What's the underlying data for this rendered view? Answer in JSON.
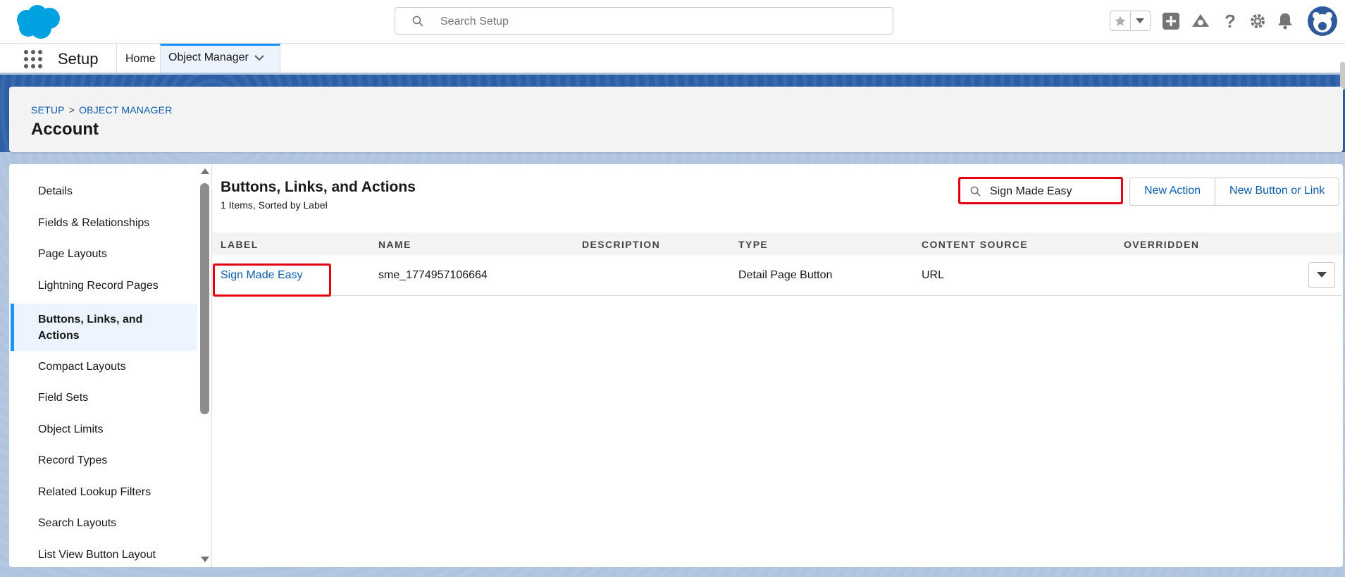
{
  "header": {
    "search_placeholder": "Search Setup"
  },
  "nav": {
    "app_name": "Setup",
    "tabs": [
      {
        "label": "Home"
      },
      {
        "label": "Object Manager"
      }
    ]
  },
  "page": {
    "breadcrumb": [
      "SETUP",
      "OBJECT MANAGER"
    ],
    "breadcrumb_separator": ">",
    "title": "Account"
  },
  "sidebar": {
    "items": [
      {
        "label": "Details"
      },
      {
        "label": "Fields & Relationships"
      },
      {
        "label": "Page Layouts"
      },
      {
        "label": "Lightning Record Pages"
      },
      {
        "label": "Buttons, Links, and Actions",
        "active": true
      },
      {
        "label": "Compact Layouts"
      },
      {
        "label": "Field Sets"
      },
      {
        "label": "Object Limits"
      },
      {
        "label": "Record Types"
      },
      {
        "label": "Related Lookup Filters"
      },
      {
        "label": "Search Layouts"
      },
      {
        "label": "List View Button Layout"
      }
    ]
  },
  "content": {
    "title": "Buttons, Links, and Actions",
    "subtitle": "1 Items, Sorted by Label",
    "filter_value": "Sign Made Easy",
    "buttons": {
      "new_action": "New Action",
      "new_button_or_link": "New Button or Link"
    },
    "table": {
      "columns": [
        "LABEL",
        "NAME",
        "DESCRIPTION",
        "TYPE",
        "CONTENT SOURCE",
        "OVERRIDDEN"
      ],
      "rows": [
        {
          "label": "Sign Made Easy",
          "name": "sme_1774957106664",
          "description": "",
          "type": "Detail Page Button",
          "content_source": "URL",
          "overridden": ""
        }
      ]
    }
  },
  "colors": {
    "brand_blue": "#0b5cab",
    "accent_blue": "#1b96ff",
    "highlight_red": "#e4000f",
    "logo_blue": "#00a1e0"
  }
}
